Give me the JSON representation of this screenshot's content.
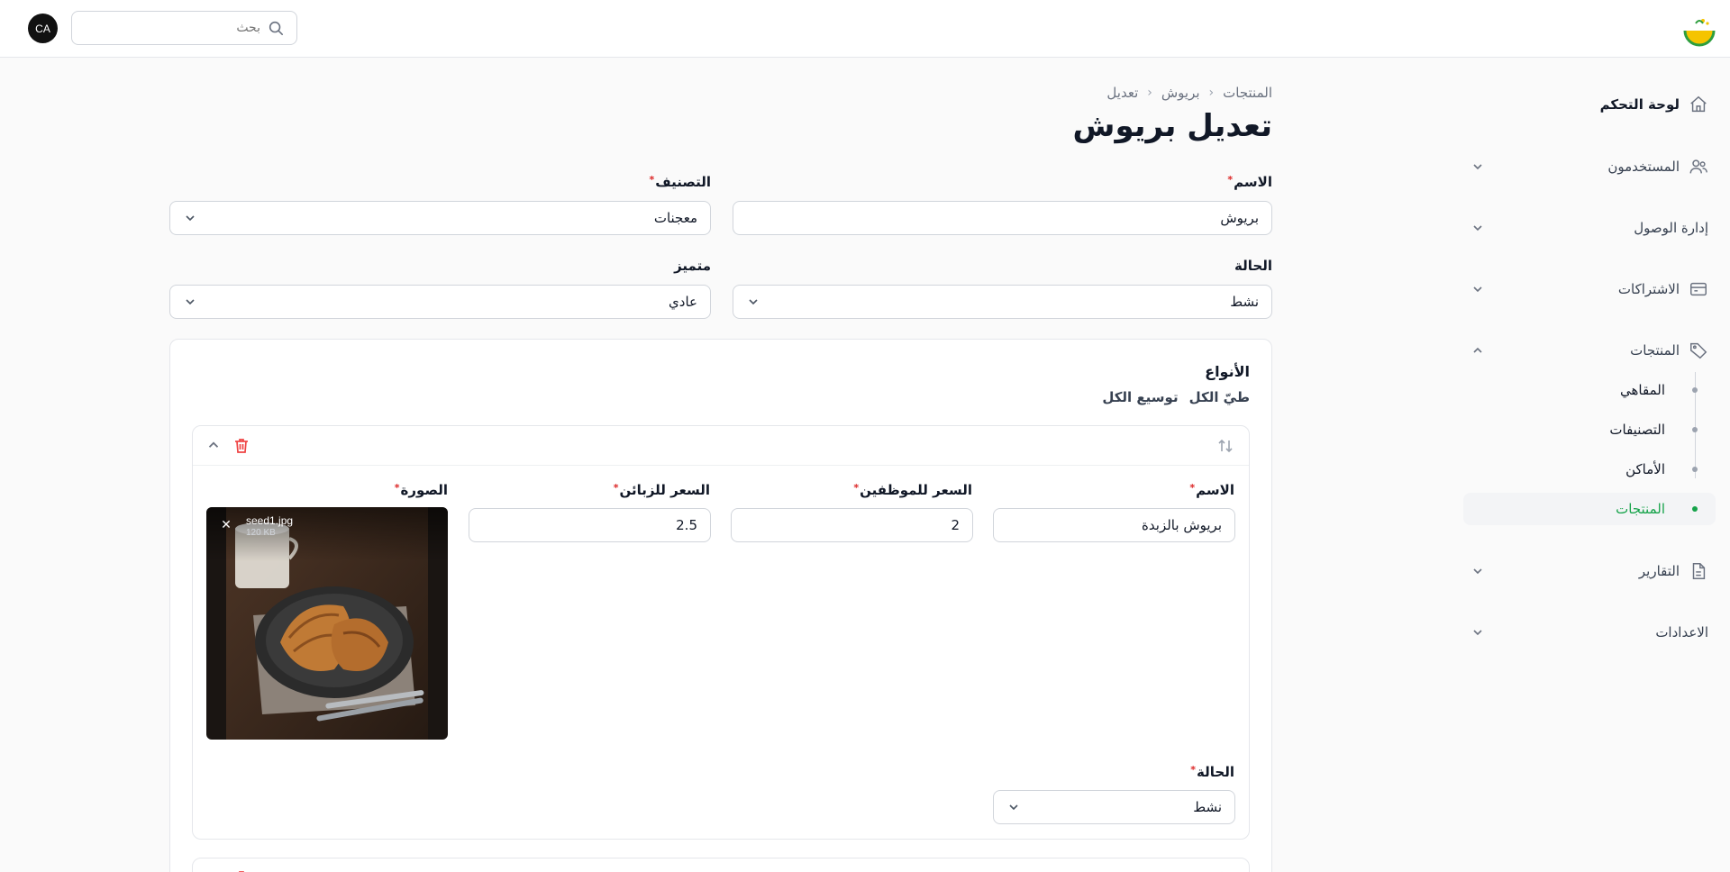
{
  "header": {
    "search_placeholder": "بحث",
    "avatar_initials": "CA"
  },
  "sidebar": {
    "items": [
      {
        "label": "لوحة التحكم"
      },
      {
        "label": "المستخدمون"
      },
      {
        "label": "إدارة الوصول"
      },
      {
        "label": "الاشتراكات"
      },
      {
        "label": "المنتجات"
      },
      {
        "label": "التقارير"
      },
      {
        "label": "الاعدادات"
      }
    ],
    "sub_items": [
      {
        "label": "المقاهي"
      },
      {
        "label": "التصنيفات"
      },
      {
        "label": "الأماكن"
      },
      {
        "label": "المنتجات"
      }
    ]
  },
  "main": {
    "breadcrumb": [
      "المنتجات",
      "بريوش",
      "تعديل"
    ],
    "title": "تعديل بريوش",
    "name_label": "الاسم",
    "name_value": "بريوش",
    "category_label": "التصنيف",
    "category_value": "معجنات",
    "status_label": "الحالة",
    "status_value": "نشط",
    "featured_label": "متميز",
    "featured_value": "عادي",
    "types": {
      "title": "الأنواع",
      "collapse_all": "طيّ الكل",
      "expand_all": "توسيع الكل",
      "item": {
        "name_label": "الاسم",
        "name_value": "بريوش بالزبدة",
        "employee_price_label": "السعر للموظفين",
        "employee_price_value": "2",
        "customer_price_label": "السعر للزبائن",
        "customer_price_value": "2.5",
        "image_label": "الصورة",
        "image_filename": "seed1.jpg",
        "image_size": "120 KB",
        "status_label": "الحالة",
        "status_value": "نشط"
      }
    }
  },
  "colors": {
    "accent": "#16a34a",
    "danger": "#ef4444",
    "required": "#dc2626"
  }
}
